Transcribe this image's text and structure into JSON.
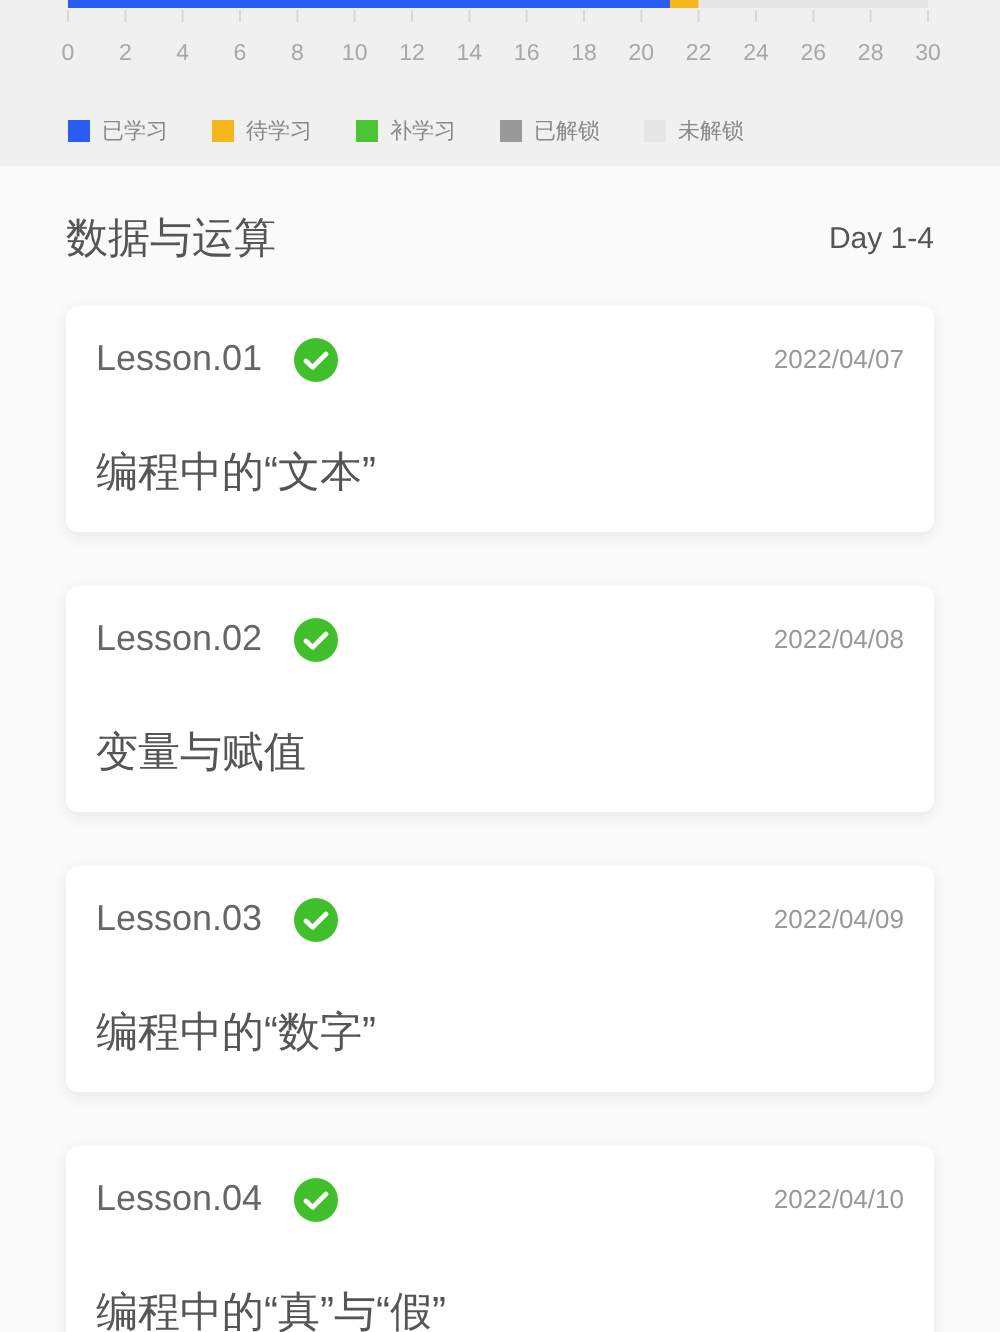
{
  "progress": {
    "chart_data": {
      "type": "bar",
      "orientation": "horizontal",
      "stacked": true,
      "grid": true,
      "xlim": [
        0,
        30
      ],
      "xticks": [
        0,
        2,
        4,
        6,
        8,
        10,
        12,
        14,
        16,
        18,
        20,
        22,
        24,
        26,
        28,
        30
      ],
      "legend": "bottom",
      "series": [
        {
          "name": "已学习",
          "color": "#2a5df5",
          "values": [
            21
          ]
        },
        {
          "name": "待学习",
          "color": "#f5b71a",
          "values": [
            1
          ]
        },
        {
          "name": "补学习",
          "color": "#4cc534",
          "values": [
            0
          ]
        },
        {
          "name": "已解锁",
          "color": "#999999",
          "values": [
            0
          ]
        },
        {
          "name": "未解锁",
          "color": "#e6e6e6",
          "values": [
            8
          ]
        }
      ]
    }
  },
  "section": {
    "title": "数据与运算",
    "range": "Day 1-4"
  },
  "lessons": [
    {
      "number": "Lesson.01",
      "done": true,
      "date": "2022/04/07",
      "title": "编程中的“文本”"
    },
    {
      "number": "Lesson.02",
      "done": true,
      "date": "2022/04/08",
      "title": "变量与赋值"
    },
    {
      "number": "Lesson.03",
      "done": true,
      "date": "2022/04/09",
      "title": "编程中的“数字”"
    },
    {
      "number": "Lesson.04",
      "done": true,
      "date": "2022/04/10",
      "title": "编程中的“真”与“假”"
    }
  ]
}
